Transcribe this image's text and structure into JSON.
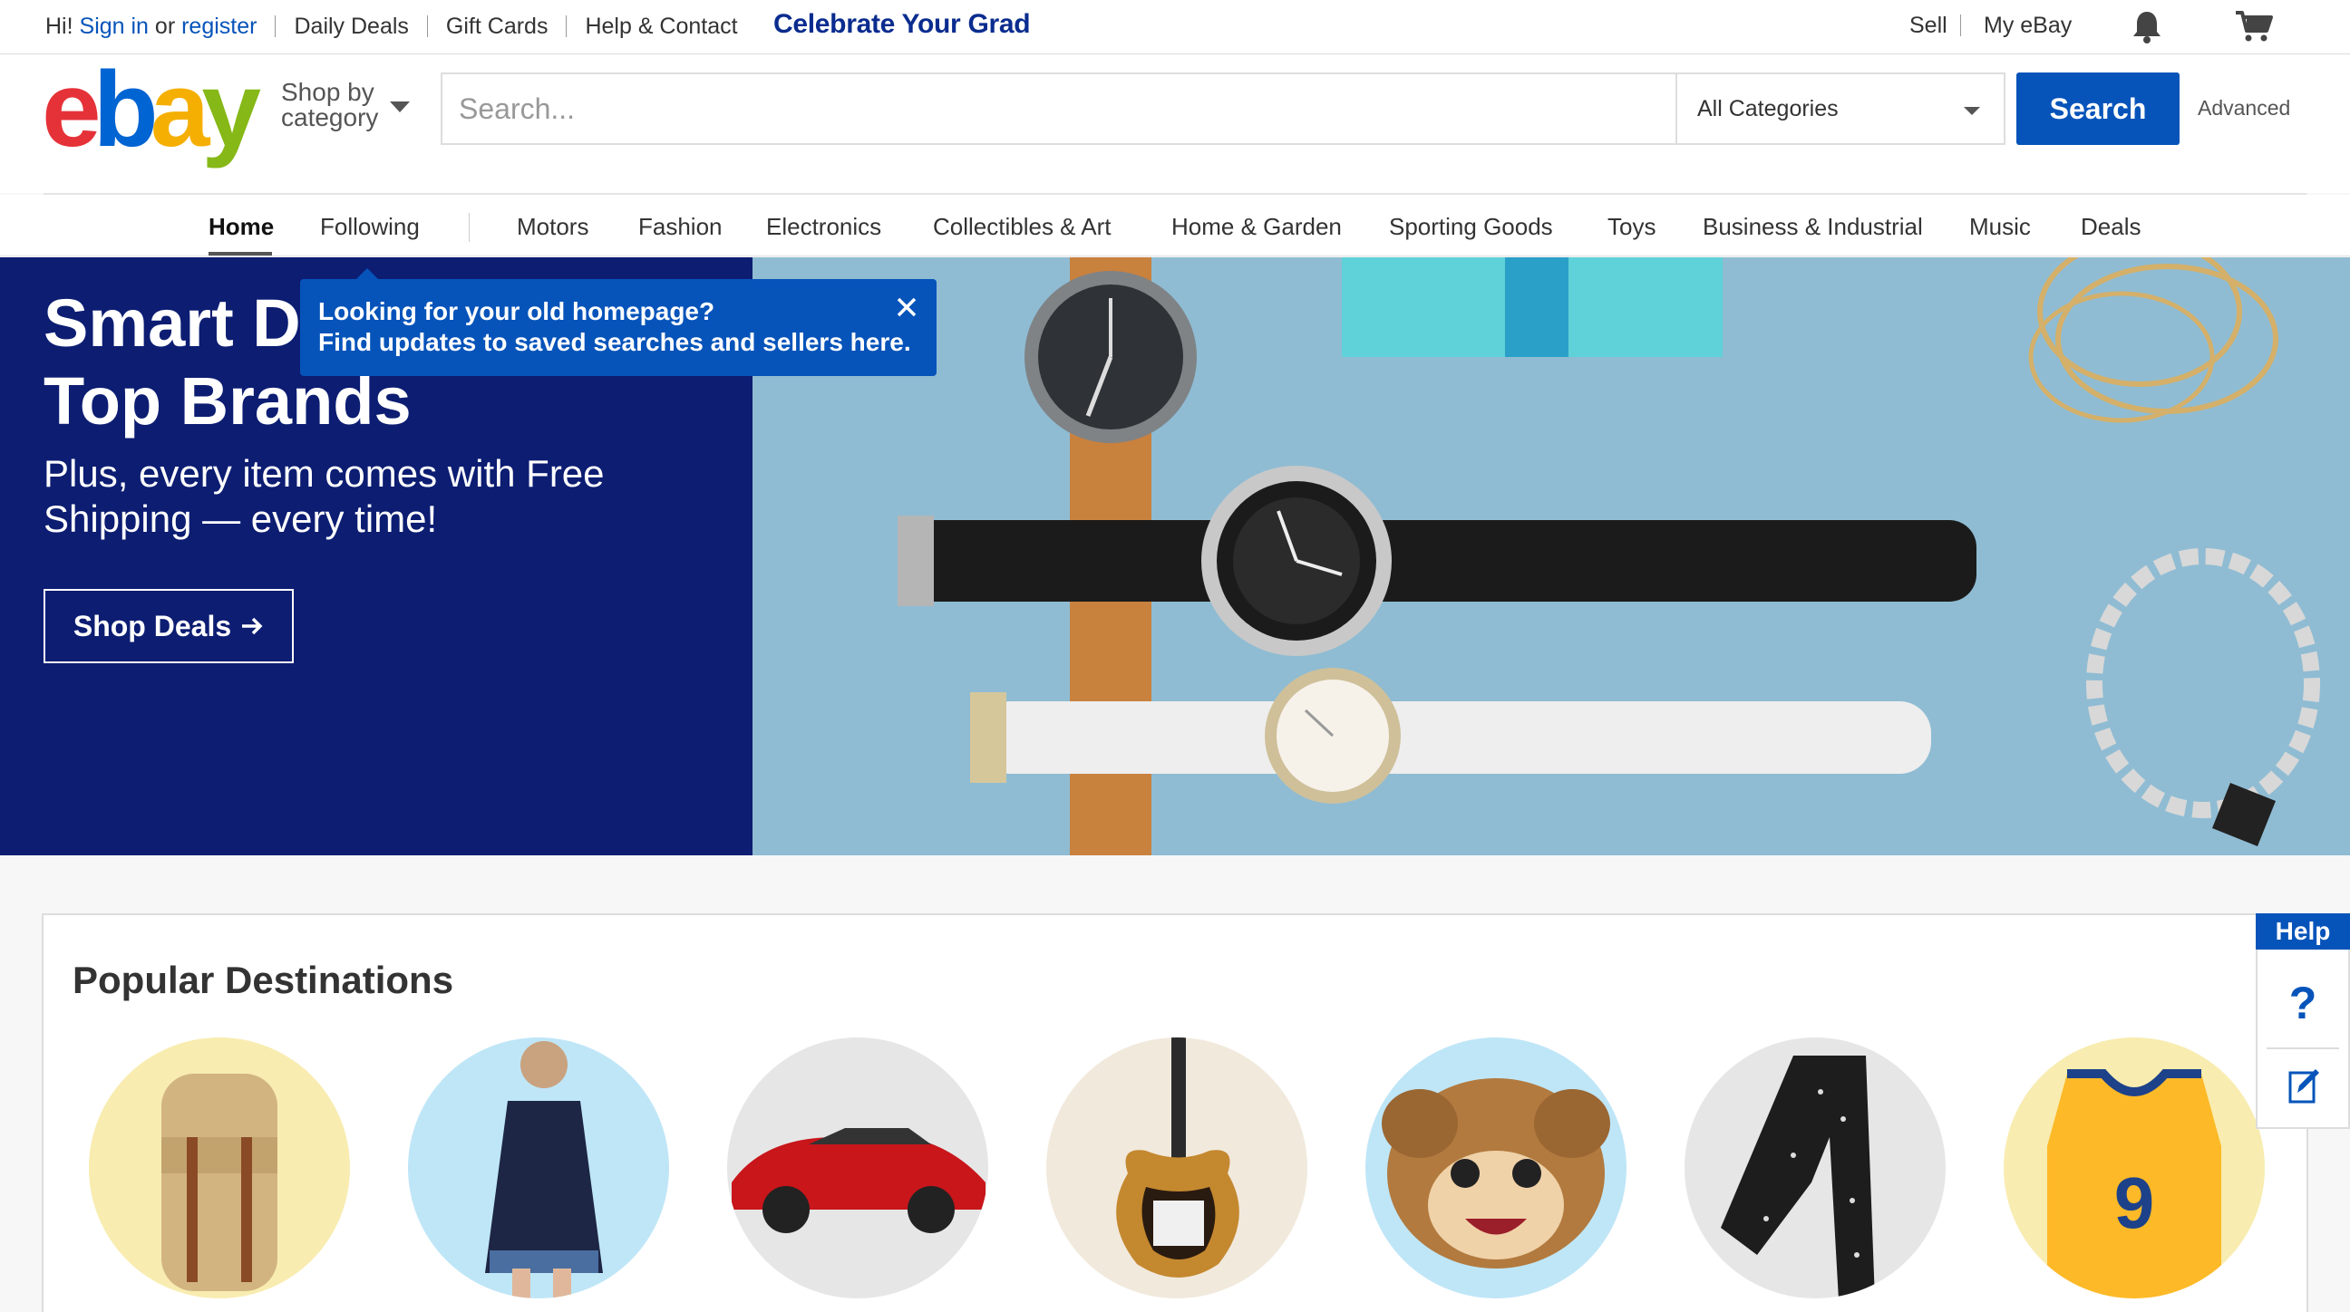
{
  "topbar": {
    "greeting_hi": "Hi!",
    "sign_in": "Sign in",
    "or": "or",
    "register": "register",
    "daily_deals": "Daily Deals",
    "gift_cards": "Gift Cards",
    "help_contact": "Help & Contact",
    "promo": "Celebrate Your Grad",
    "sell": "Sell",
    "my_ebay": "My eBay",
    "icons": [
      "bell-icon",
      "cart-icon"
    ]
  },
  "header": {
    "logo_letters": [
      "e",
      "b",
      "a",
      "y"
    ],
    "logo_colors": [
      "#e53238",
      "#0064d2",
      "#f5af02",
      "#86b817"
    ],
    "shop_by_line1": "Shop by",
    "shop_by_line2": "category",
    "search_placeholder": "Search...",
    "category_selected": "All Categories",
    "search_button": "Search",
    "advanced": "Advanced"
  },
  "nav": {
    "items": [
      "Home",
      "Following",
      "Motors",
      "Fashion",
      "Electronics",
      "Collectibles & Art",
      "Home & Garden",
      "Sporting Goods",
      "Toys",
      "Business & Industrial",
      "Music",
      "Deals"
    ],
    "active": "Home"
  },
  "hero": {
    "title": "Smart Deals on\nTop Brands",
    "subtitle": "Plus, every item comes with Free Shipping — every time!",
    "button": "Shop Deals",
    "image_subject": "watches and bracelets on blue background",
    "bg_color": "#0c1d72"
  },
  "tooltip": {
    "line1": "Looking for your old homepage?",
    "line2": "Find updates to saved searches and sellers here."
  },
  "popular": {
    "title": "Popular Destinations",
    "items": [
      "backpack",
      "dress",
      "sports-car",
      "electric-guitar",
      "monkey-emoji-pillow",
      "leggings",
      "basketball-jersey"
    ]
  },
  "help": {
    "tab": "Help",
    "question": "?"
  },
  "colors": {
    "accent_blue": "#0654ba",
    "hero_navy": "#0c1d72"
  }
}
